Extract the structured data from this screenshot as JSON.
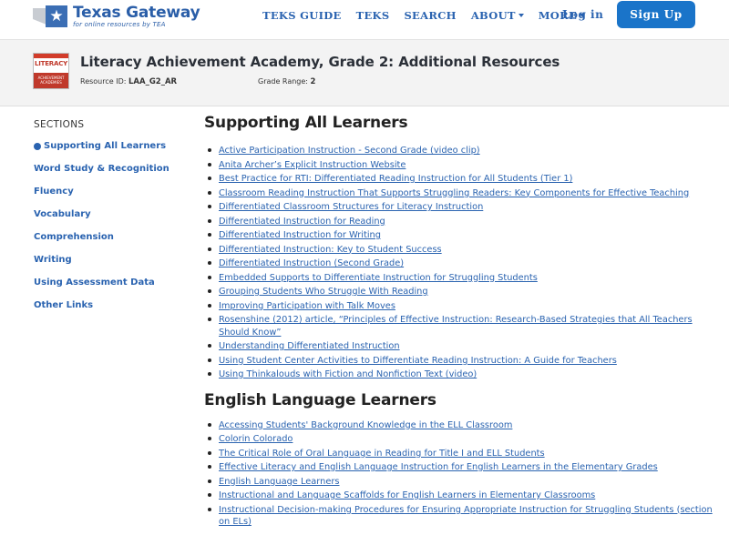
{
  "header": {
    "logo_title": "Texas Gateway",
    "logo_sub": "for online resources by TEA",
    "nav": [
      {
        "label": "TEKS GUIDE",
        "dropdown": false
      },
      {
        "label": "TEKS",
        "dropdown": false
      },
      {
        "label": "SEARCH",
        "dropdown": false
      },
      {
        "label": "ABOUT",
        "dropdown": true
      },
      {
        "label": "MORE",
        "dropdown": true
      }
    ],
    "login": "Log in",
    "signup": "Sign Up"
  },
  "resource": {
    "thumb_word": "LITERACY",
    "thumb_band": "ACHIEVEMENT ACADEMIES",
    "title": "Literacy Achievement Academy, Grade 2: Additional Resources",
    "id_label": "Resource ID:",
    "id_value": "LAA_G2_AR",
    "grade_label": "Grade Range:",
    "grade_value": "2"
  },
  "sidebar": {
    "heading": "SECTIONS",
    "items": [
      {
        "label": "Supporting All Learners",
        "active": true
      },
      {
        "label": "Word Study & Recognition",
        "active": false
      },
      {
        "label": "Fluency",
        "active": false
      },
      {
        "label": "Vocabulary",
        "active": false
      },
      {
        "label": "Comprehension",
        "active": false
      },
      {
        "label": "Writing",
        "active": false
      },
      {
        "label": "Using Assessment Data",
        "active": false
      },
      {
        "label": "Other Links",
        "active": false
      }
    ]
  },
  "main": {
    "sections": [
      {
        "heading": "Supporting All Learners",
        "links": [
          "Active Participation Instruction - Second Grade (video clip)",
          "Anita Archer’s Explicit Instruction Website",
          "Best Practice for RTI: Differentiated Reading Instruction for All Students (Tier 1)",
          "Classroom Reading Instruction That Supports Struggling Readers:  Key Components for Effective Teaching",
          "Differentiated Classroom Structures for Literacy Instruction",
          "Differentiated Instruction for Reading",
          "Differentiated Instruction for Writing",
          "Differentiated Instruction: Key to Student Success",
          "Differentiated Instruction (Second Grade)",
          "Embedded Supports to Differentiate Instruction for Struggling Students",
          "Grouping Students Who Struggle With Reading",
          "Improving Participation with Talk Moves",
          "Rosenshine (2012) article, “Principles of Effective Instruction: Research-Based Strategies that All Teachers Should Know”",
          "Understanding Differentiated Instruction",
          "Using Student Center Activities to Differentiate Reading Instruction: A Guide for Teachers",
          "Using Thinkalouds with Fiction and Nonfiction Text (video)"
        ]
      },
      {
        "heading": "English Language Learners",
        "links": [
          "Accessing Students' Background Knowledge in the ELL Classroom",
          "Colorin Colorado",
          "The Critical Role of Oral Language in Reading for Title I and ELL Students",
          "Effective Literacy and English Language Instruction for English Learners in the Elementary Grades",
          "English Language Learners",
          "Instructional and Language Scaffolds for English Learners in Elementary Classrooms",
          "Instructional Decision-making Procedures for Ensuring Appropriate Instruction for Struggling Students (section on ELs)"
        ]
      }
    ]
  }
}
